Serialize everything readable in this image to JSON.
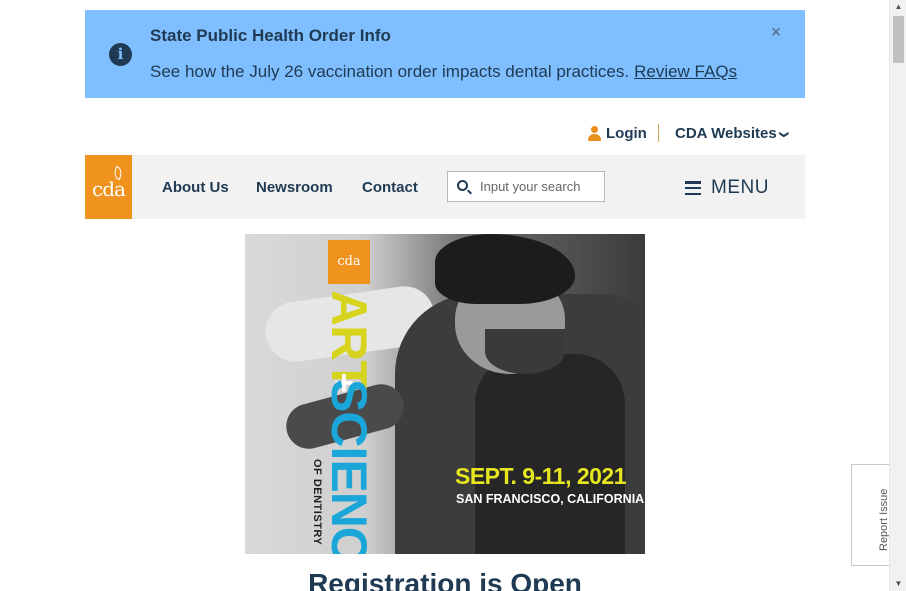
{
  "alert": {
    "title": "State Public Health Order Info",
    "message": "See how the July 26 vaccination order impacts dental practices.",
    "link_label": "Review FAQs",
    "info_icon": "i",
    "close_icon": "×"
  },
  "utility": {
    "login_label": "Login",
    "sites_label": "CDA Websites",
    "sites_chevron": "❯"
  },
  "logo": {
    "text": "cda"
  },
  "nav": {
    "links": [
      "About Us",
      "Newsroom",
      "Contact"
    ],
    "search_placeholder": "Input your search",
    "menu_label": "MENU"
  },
  "hero": {
    "logo_text": "cda",
    "word_1": "ART",
    "plus": "+",
    "word_2": "SCIENCE",
    "sub": "OF DENTISTRY",
    "date": "SEPT. 9-11, 2021",
    "city": "SAN FRANCISCO, CALIFORNIA"
  },
  "main": {
    "heading": "Registration is Open"
  },
  "report": {
    "label": "Report Issue"
  },
  "scrollbar": {
    "up": "▲",
    "down": "▼"
  },
  "colors": {
    "alert_bg": "#7fbfff",
    "navy": "#1f3a52",
    "brand_orange": "#f0921e",
    "nav_bg": "#f2f2f2"
  }
}
